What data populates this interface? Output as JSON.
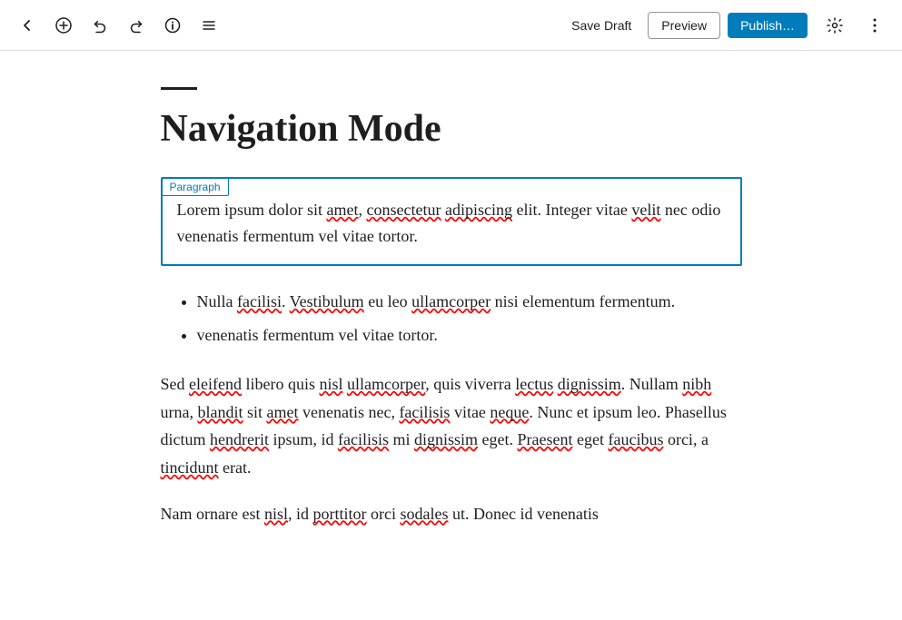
{
  "toolbar": {
    "back_icon": "←",
    "add_icon": "+",
    "undo_icon": "↺",
    "redo_icon": "↻",
    "info_icon": "ⓘ",
    "menu_icon": "≡",
    "save_draft_label": "Save Draft",
    "preview_label": "Preview",
    "publish_label": "Publish…",
    "settings_icon": "⚙",
    "more_icon": "⋮"
  },
  "editor": {
    "divider": "",
    "title": "Navigation Mode",
    "paragraph_block_label": "Paragraph",
    "paragraph_text": "Lorem ipsum dolor sit amet, consectetur adipiscing elit. Integer vitae velit nec odio venenatis fermentum vel vitae tortor.",
    "list_items": [
      "Nulla facilisi. Vestibulum eu leo ullamcorper nisi elementum fermentum.",
      "venenatis fermentum vel vitae tortor."
    ],
    "body_paragraphs": [
      "Sed eleifend libero quis nisl ullamcorper, quis viverra lectus dignissim. Nullam nibh urna, blandit sit amet venenatis nec, facilisis vitae neque. Nunc et ipsum leo. Phasellus dictum hendrerit ipsum, id facilisis mi dignissim eget. Praesent eget faucibus orci, a tincidunt erat.",
      "Nam ornare est nisl, id porttitor orci sodales ut. Donec id venenatis"
    ]
  }
}
